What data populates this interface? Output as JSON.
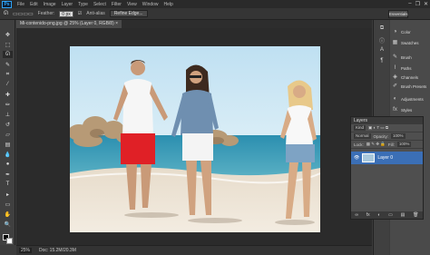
{
  "app": {
    "logo": "Ps"
  },
  "menu": [
    "File",
    "Edit",
    "Image",
    "Layer",
    "Type",
    "Select",
    "Filter",
    "View",
    "Window",
    "Help"
  ],
  "window_controls": [
    "–",
    "❐",
    "✕"
  ],
  "options": {
    "feather_label": "Feather:",
    "feather_value": "0 px",
    "antialias_label": "Anti-alias",
    "refine_edge_label": "Refine Edge..."
  },
  "workspace": {
    "label": "Essentials"
  },
  "document": {
    "tab_title": "Mi-contenido-png.jpg @ 25% (Layer 0, RGB/8)",
    "close": "×"
  },
  "status": {
    "zoom": "25%",
    "doc_size": "Doc: 15.2M/20.3M"
  },
  "panels": [
    {
      "icon": "color-icon",
      "label": "Color"
    },
    {
      "icon": "swatches-icon",
      "label": "Swatches"
    },
    {
      "icon": "brush-icon",
      "label": "Brush"
    },
    {
      "icon": "paths-icon",
      "label": "Paths"
    },
    {
      "icon": "channels-icon",
      "label": "Channels"
    },
    {
      "icon": "brush-presets-icon",
      "label": "Brush Presets"
    },
    {
      "icon": "adjustments-icon",
      "label": "Adjustments"
    },
    {
      "icon": "styles-icon",
      "label": "Styles"
    }
  ],
  "layers": {
    "title": "Layers",
    "kind_label": "Kind",
    "blend_mode": "Normal",
    "opacity_label": "Opacity:",
    "opacity_value": "100%",
    "lock_label": "Lock:",
    "fill_label": "Fill:",
    "fill_value": "100%",
    "layer_name": "Layer 0",
    "footer_icons": [
      "∞",
      "fx",
      "◐",
      "▭",
      "▤",
      "🗑"
    ]
  },
  "colors": {
    "accent": "#3b6fb6",
    "ps_blue": "#2fa3f7"
  }
}
